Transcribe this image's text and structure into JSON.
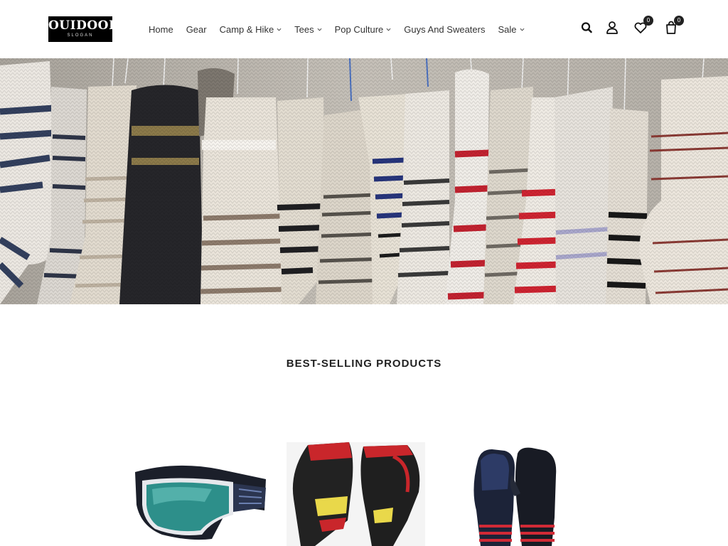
{
  "brand": {
    "logo_text": "OUIDOORI",
    "logo_slogan": "SLOGAN"
  },
  "nav": {
    "items": [
      {
        "label": "Home",
        "has_dropdown": false
      },
      {
        "label": "Gear",
        "has_dropdown": false
      },
      {
        "label": "Camp & Hike",
        "has_dropdown": true
      },
      {
        "label": "Tees",
        "has_dropdown": true
      },
      {
        "label": "Pop Culture",
        "has_dropdown": true
      },
      {
        "label": "Guys And Sweaters",
        "has_dropdown": false
      },
      {
        "label": "Sale",
        "has_dropdown": true
      }
    ]
  },
  "header_icons": {
    "search": "search-icon",
    "account": "user-icon",
    "wishlist": {
      "icon": "heart-icon",
      "count": "0"
    },
    "cart": {
      "icon": "shopping-bag-icon",
      "count": "0"
    }
  },
  "hero": {
    "image": "hanging-knitted-wool-socks"
  },
  "best_sellers": {
    "title": "BEST-SELLING PRODUCTS",
    "products": [
      {
        "image": "ski-goggles"
      },
      {
        "image": "red-black-racing-gloves"
      },
      {
        "image": "black-shred-mittens"
      }
    ]
  },
  "colors": {
    "text": "#222222",
    "badge": "#222222",
    "background": "#ffffff"
  }
}
